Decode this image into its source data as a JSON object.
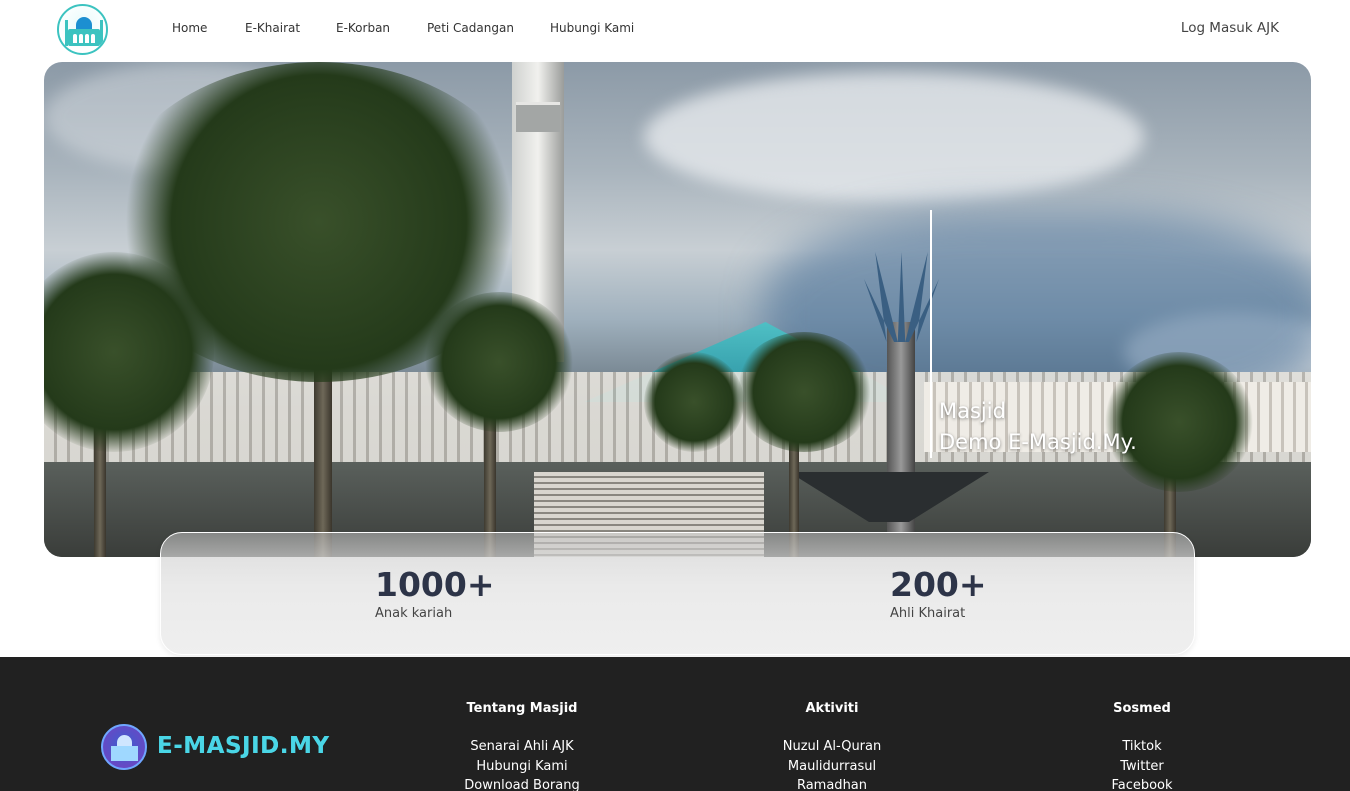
{
  "nav": {
    "logo_icon": "mosque-logo-icon",
    "links": [
      "Home",
      "E-Khairat",
      "E-Korban",
      "Peti Cadangan",
      "Hubungi Kami"
    ],
    "login": "Log Masuk AJK"
  },
  "hero": {
    "title_line1": "Masjid",
    "title_line2": "Demo E-Masjid.My."
  },
  "stats": [
    {
      "value": "1000+",
      "label": "Anak kariah"
    },
    {
      "value": "200+",
      "label": "Ahli Khairat"
    }
  ],
  "footer": {
    "brand": "E-MASJID.MY",
    "columns": [
      {
        "title": "Tentang Masjid",
        "items": [
          "Senarai Ahli AJK",
          "Hubungi Kami",
          "Download Borang"
        ]
      },
      {
        "title": "Aktiviti",
        "items": [
          "Nuzul Al-Quran",
          "Maulidurrasul",
          "Ramadhan"
        ]
      },
      {
        "title": "Sosmed",
        "items": [
          "Tiktok",
          "Twitter",
          "Facebook"
        ]
      }
    ]
  },
  "colors": {
    "footer_bg": "#212121",
    "brand_accent": "#4ad6e6",
    "stat_text": "#2d3448"
  }
}
